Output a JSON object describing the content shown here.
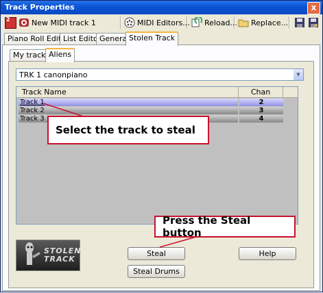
{
  "window": {
    "title": "Track Properties",
    "close_label": "x"
  },
  "toolbar": {
    "track_number": "2",
    "track_name": "New MIDI track 1",
    "midi_editors": "MIDI Editors...",
    "reload": "Reload...",
    "replace": "Replace..."
  },
  "tabs": [
    "Piano Roll Editor",
    "List Editor",
    "General",
    "Stolen Track"
  ],
  "subtabs": [
    "My tracks",
    "Aliens"
  ],
  "combo": {
    "selected": "TRK 1 canonpiano"
  },
  "table": {
    "headers": [
      "Track Name",
      "Chan"
    ],
    "rows": [
      {
        "name": "Track 1",
        "chan": "2"
      },
      {
        "name": "Track 2",
        "chan": "3"
      },
      {
        "name": "Track 3",
        "chan": "4"
      }
    ]
  },
  "callouts": {
    "select": "Select the track to steal",
    "steal": "Press the Steal button"
  },
  "buttons": {
    "steal": "Steal",
    "steal_drums": "Steal Drums",
    "help": "Help"
  },
  "logo": {
    "line1": "STOLEN",
    "line2": "TRACK"
  },
  "colors": {
    "title_bar": "#0b56d6",
    "callout_border": "#c8102e",
    "active_tab": "#f8b33d"
  }
}
